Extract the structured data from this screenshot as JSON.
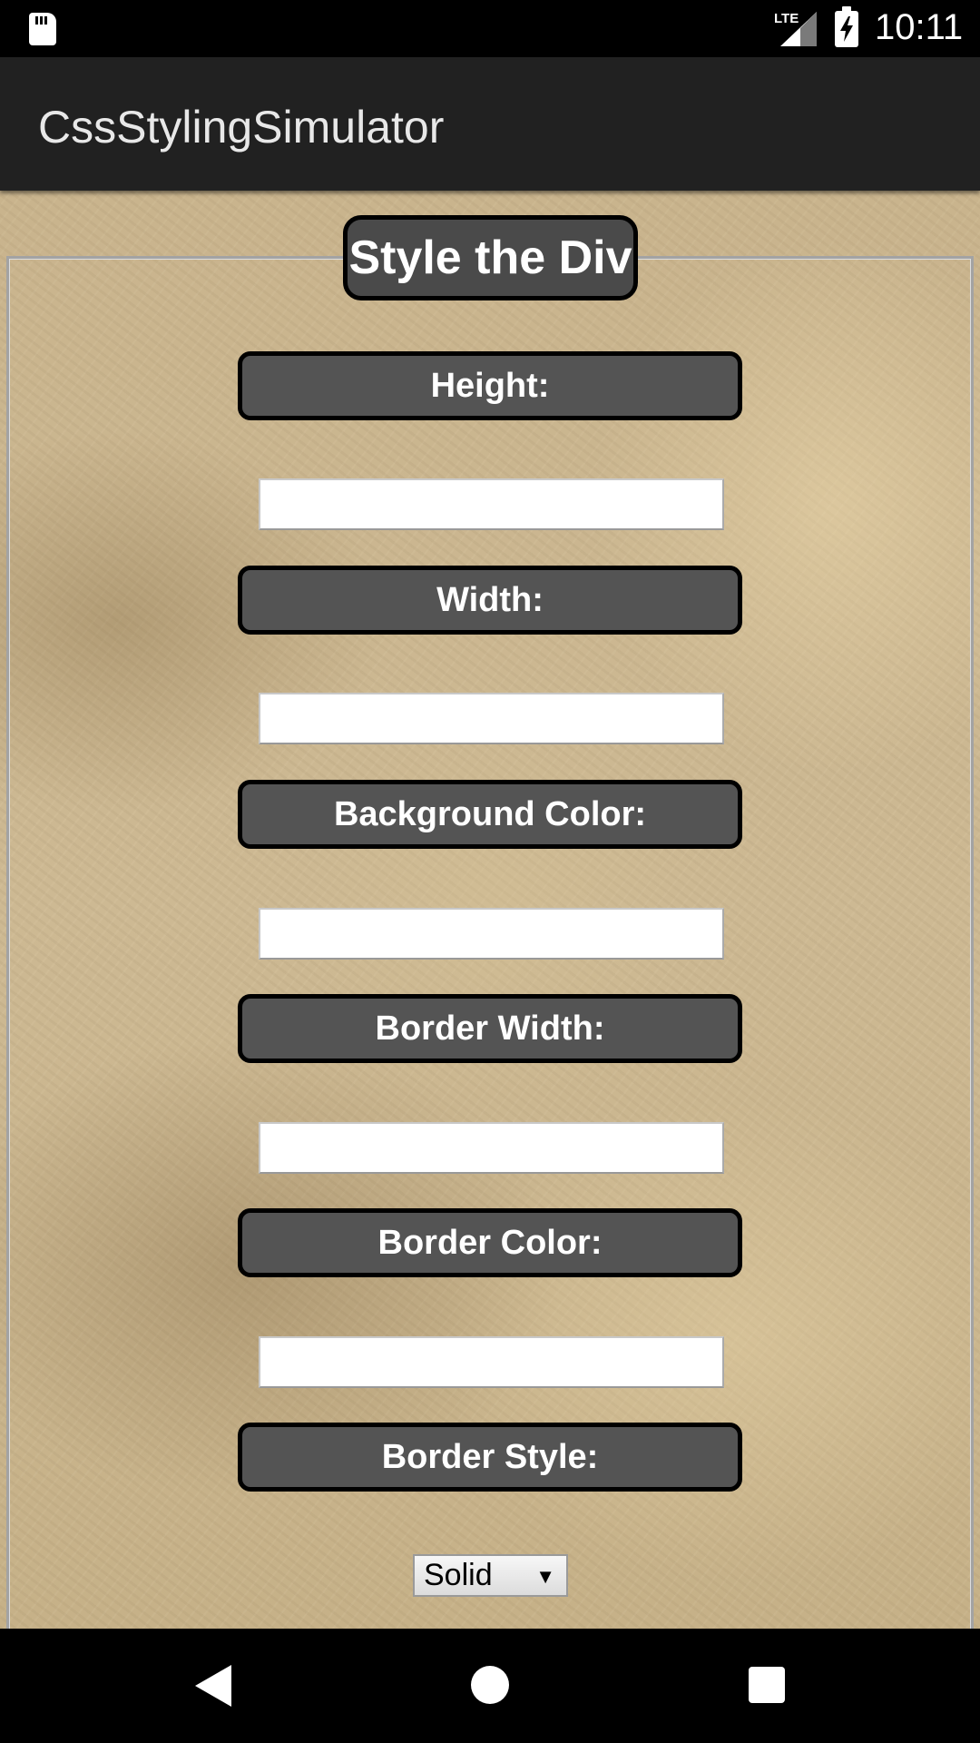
{
  "status_bar": {
    "network": "LTE",
    "time": "10:11",
    "icons": [
      "sd-card-icon",
      "signal-icon",
      "battery-charging-icon"
    ]
  },
  "app_bar": {
    "title": "CssStylingSimulator"
  },
  "form": {
    "legend": "Style the Div",
    "fields": [
      {
        "label": "Height:",
        "value": ""
      },
      {
        "label": "Width:",
        "value": ""
      },
      {
        "label": "Background Color:",
        "value": ""
      },
      {
        "label": "Border Width:",
        "value": ""
      },
      {
        "label": "Border Color:",
        "value": ""
      }
    ],
    "border_style": {
      "label": "Border Style:",
      "selected": "Solid"
    }
  },
  "nav_bar": {
    "icons": [
      "back-icon",
      "home-icon",
      "recents-icon"
    ]
  },
  "colors": {
    "app_bar": "#212121",
    "label_bg": "#545454",
    "label_border": "#000000",
    "paper": "#c8b48c"
  }
}
